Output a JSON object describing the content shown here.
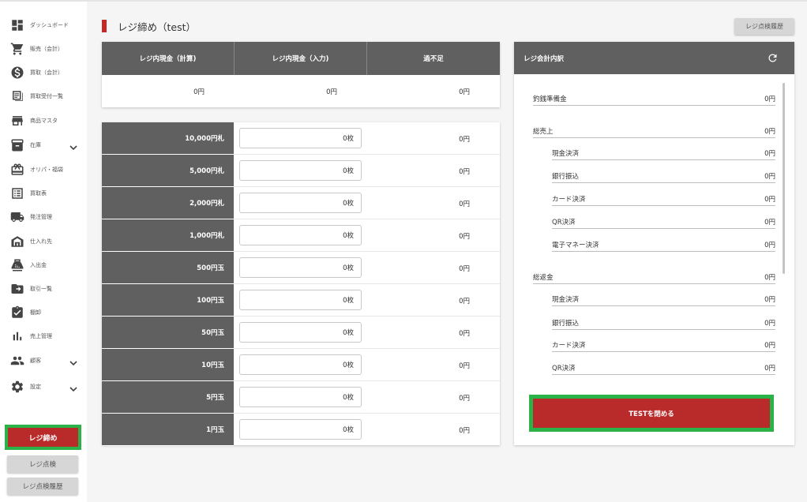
{
  "sidebar": {
    "items": [
      {
        "label": "ダッシュボード",
        "icon": "dashboard-icon"
      },
      {
        "label": "販売（会計）",
        "icon": "cart-icon"
      },
      {
        "label": "買取（会計）",
        "icon": "dollar-icon"
      },
      {
        "label": "買取受付一覧",
        "icon": "receipt-icon"
      },
      {
        "label": "商品マスタ",
        "icon": "store-icon"
      },
      {
        "label": "在庫",
        "icon": "inventory-icon"
      },
      {
        "label": "オリパ・福袋",
        "icon": "gift-icon"
      },
      {
        "label": "買取表",
        "icon": "list-icon"
      },
      {
        "label": "発注管理",
        "icon": "truck-icon"
      },
      {
        "label": "仕入れ先",
        "icon": "warehouse-icon"
      },
      {
        "label": "入出金",
        "icon": "register-icon"
      },
      {
        "label": "取引一覧",
        "icon": "folder-icon"
      },
      {
        "label": "棚卸",
        "icon": "clipboard-icon"
      },
      {
        "label": "売上管理",
        "icon": "bar-chart-icon"
      },
      {
        "label": "顧客",
        "icon": "people-icon"
      },
      {
        "label": "設定",
        "icon": "gear-icon"
      }
    ],
    "close_register": "レジ締め",
    "register_check": "レジ点検",
    "register_check_history": "レジ点検履歴"
  },
  "header": {
    "title": "レジ締め（test）",
    "history_button": "レジ点検履歴"
  },
  "summary": {
    "headers": [
      "レジ内現金（計算)",
      "レジ内現金（入力)",
      "過不足"
    ],
    "values": [
      "0円",
      "0円",
      "0円"
    ]
  },
  "denominations": [
    {
      "label": "10,000円札",
      "count": "0枚",
      "total": "0円"
    },
    {
      "label": "5,000円札",
      "count": "0枚",
      "total": "0円"
    },
    {
      "label": "2,000円札",
      "count": "0枚",
      "total": "0円"
    },
    {
      "label": "1,000円札",
      "count": "0枚",
      "total": "0円"
    },
    {
      "label": "500円玉",
      "count": "0枚",
      "total": "0円"
    },
    {
      "label": "100円玉",
      "count": "0枚",
      "total": "0円"
    },
    {
      "label": "50円玉",
      "count": "0枚",
      "total": "0円"
    },
    {
      "label": "10円玉",
      "count": "0枚",
      "total": "0円"
    },
    {
      "label": "5円玉",
      "count": "0枚",
      "total": "0円"
    },
    {
      "label": "1円玉",
      "count": "0枚",
      "total": "0円"
    }
  ],
  "breakdown": {
    "title": "レジ会計内訳",
    "change_reserve": {
      "label": "釣銭準備金",
      "value": "0円"
    },
    "total_sales": {
      "label": "総売上",
      "value": "0円"
    },
    "sales_items": [
      {
        "label": "現金決済",
        "value": "0円"
      },
      {
        "label": "銀行振込",
        "value": "0円"
      },
      {
        "label": "カード決済",
        "value": "0円"
      },
      {
        "label": "QR決済",
        "value": "0円"
      },
      {
        "label": "電子マネー決済",
        "value": "0円"
      }
    ],
    "total_refunds": {
      "label": "総返金",
      "value": "0円"
    },
    "refund_items": [
      {
        "label": "現金決済",
        "value": "0円"
      },
      {
        "label": "銀行振込",
        "value": "0円"
      },
      {
        "label": "カード決済",
        "value": "0円"
      },
      {
        "label": "QR決済",
        "value": "0円"
      }
    ],
    "close_button": "TESTを閉める"
  },
  "colors": {
    "accent_red": "#b92a2a",
    "highlight_green": "#2bb34a",
    "header_gray": "#606060"
  }
}
